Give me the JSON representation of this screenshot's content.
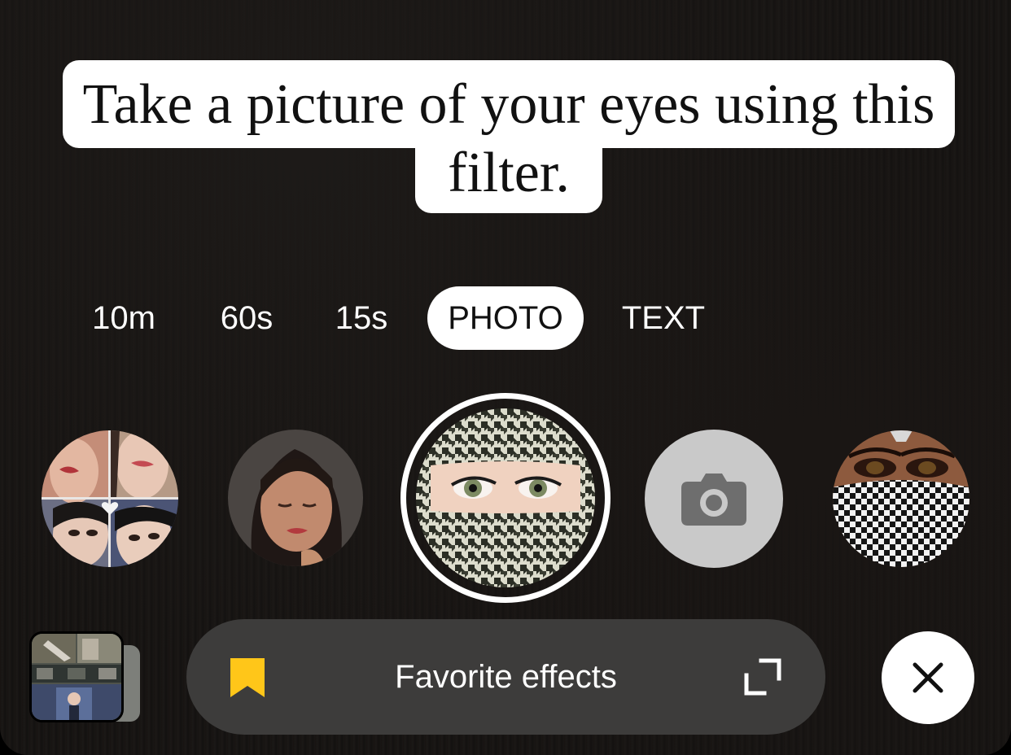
{
  "caption": {
    "line1": "Take a picture of your eyes using this",
    "line2": "filter."
  },
  "modes": [
    {
      "label": "10m",
      "active": false
    },
    {
      "label": "60s",
      "active": false
    },
    {
      "label": "15s",
      "active": false
    },
    {
      "label": "PHOTO",
      "active": true
    },
    {
      "label": "TEXT",
      "active": false
    }
  ],
  "effects": [
    {
      "icon": "collage-faces-effect"
    },
    {
      "icon": "portrait-effect"
    },
    {
      "icon": "scarf-eyes-effect",
      "selected": true
    },
    {
      "icon": "camera-icon"
    },
    {
      "icon": "checkered-mask-effect"
    }
  ],
  "favorites": {
    "label": "Favorite effects",
    "bookmark_icon": "bookmark-icon",
    "expand_icon": "expand-icon",
    "bookmark_color": "#FFC619"
  },
  "close": {
    "icon": "close-icon"
  }
}
